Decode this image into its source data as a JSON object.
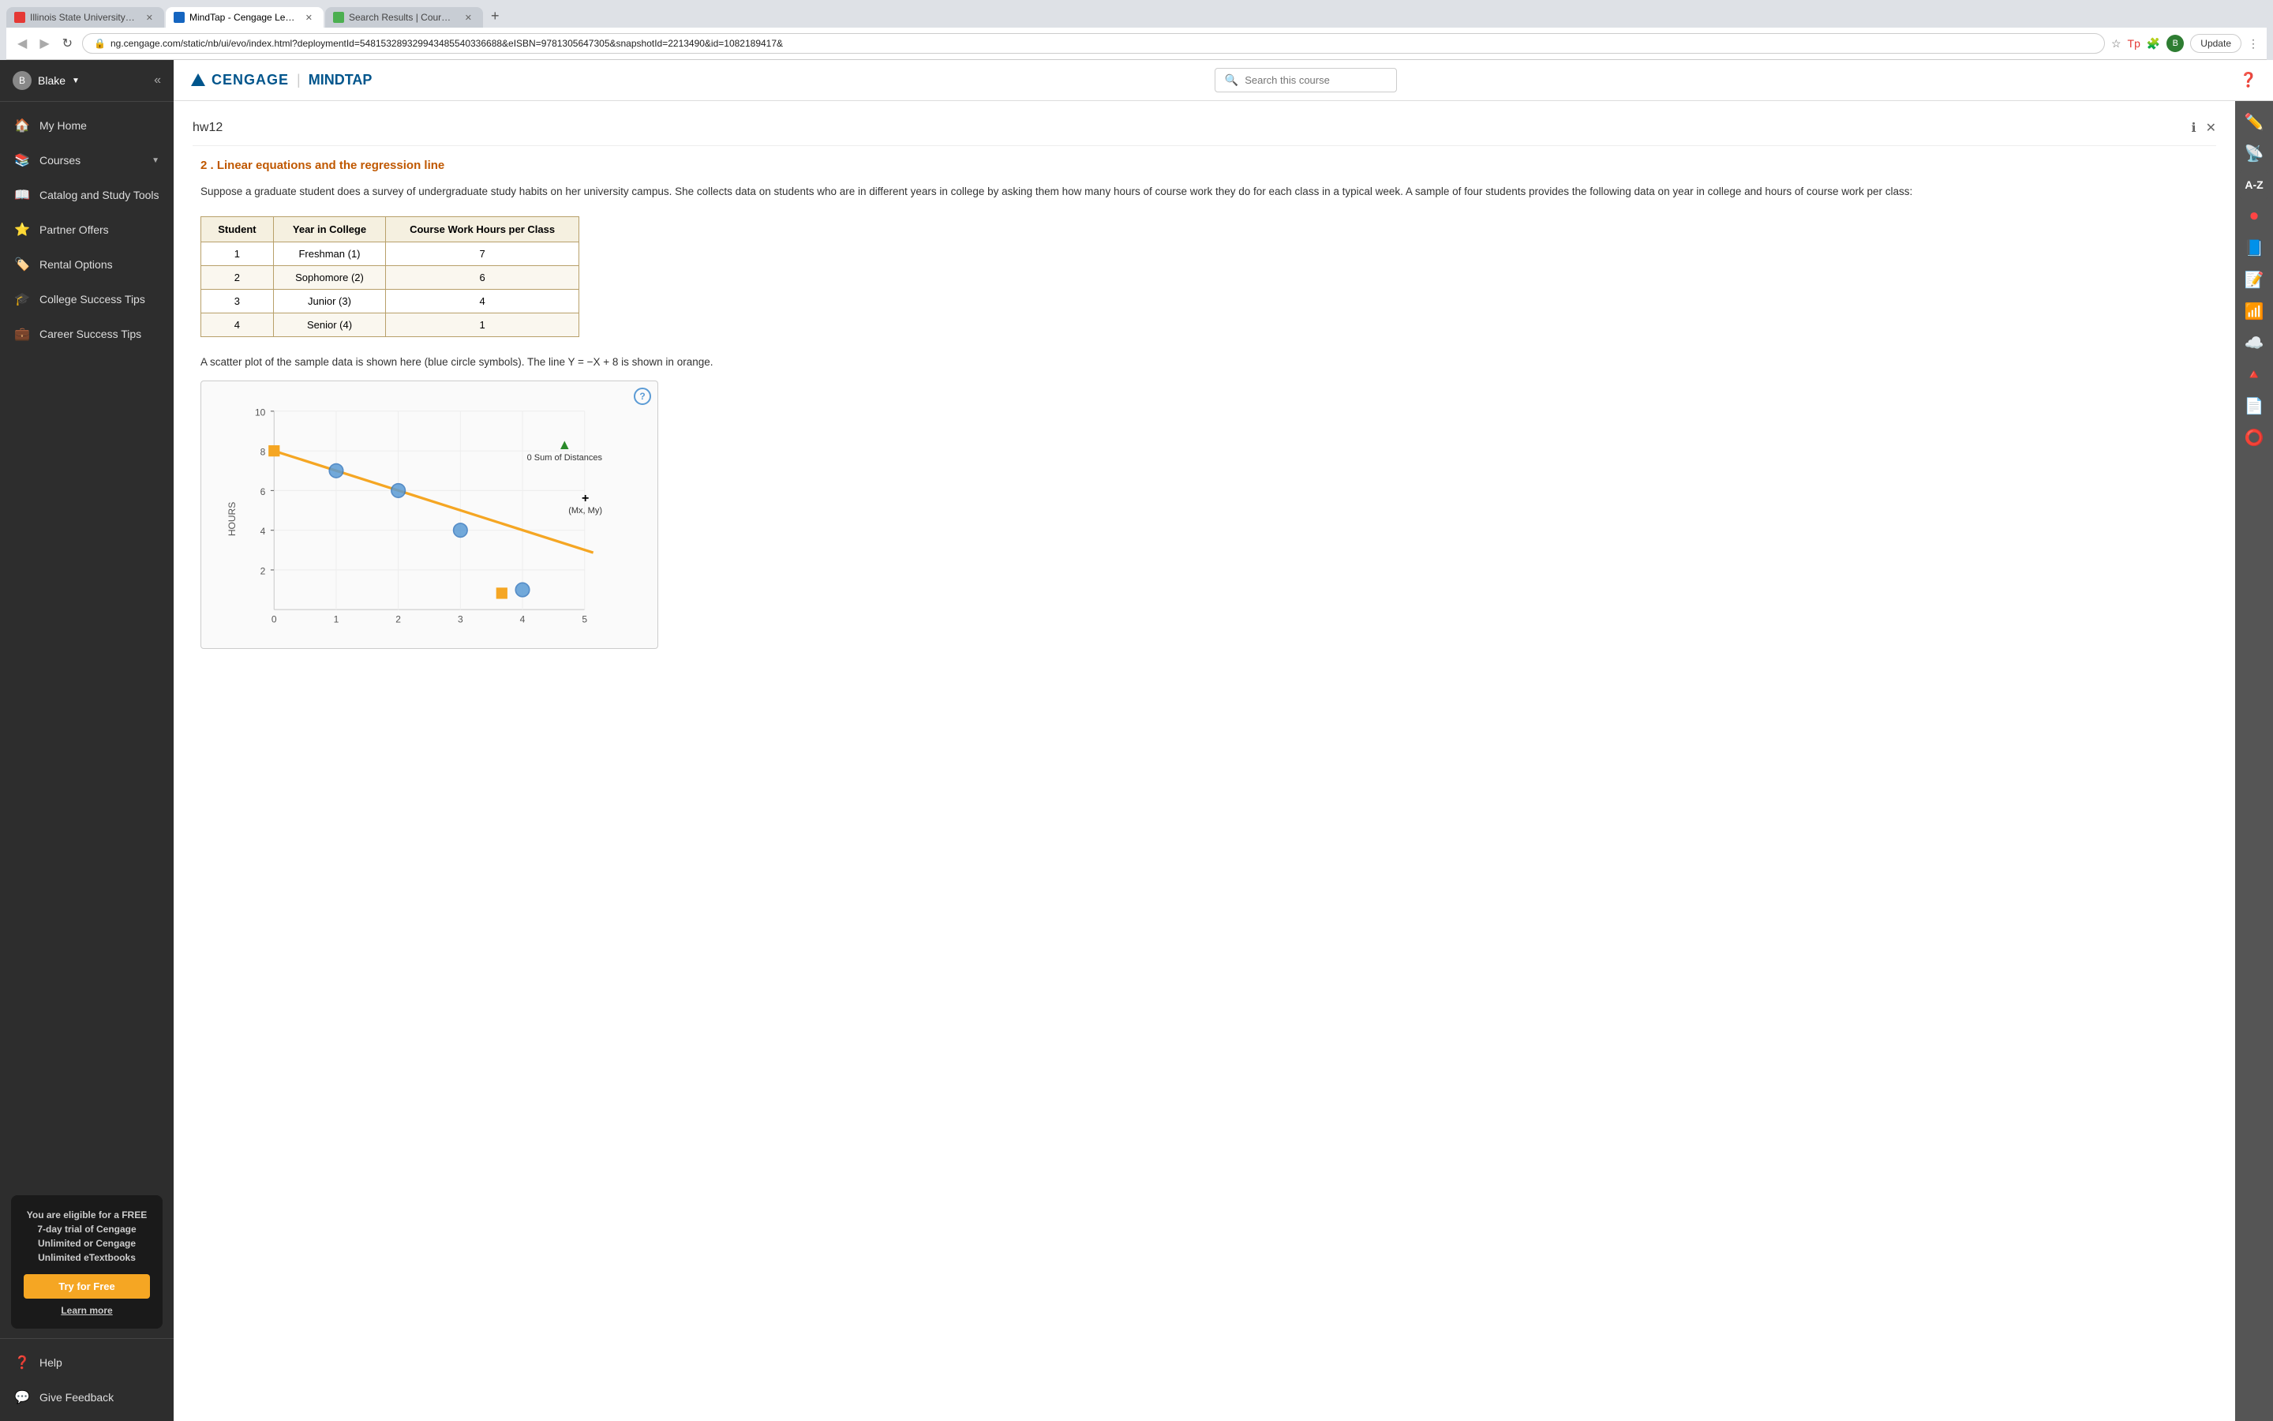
{
  "browser": {
    "tabs": [
      {
        "id": "tab1",
        "title": "Illinois State University : SOC...",
        "active": false,
        "favicon_color": "#e53935"
      },
      {
        "id": "tab2",
        "title": "MindTap - Cengage Learning",
        "active": true,
        "favicon_color": "#1565c0"
      },
      {
        "id": "tab3",
        "title": "Search Results | Course Hero",
        "active": false,
        "favicon_color": "#4caf50"
      }
    ],
    "url": "ng.cengage.com/static/nb/ui/evo/index.html?deploymentId=548153289329943485540336688&eISBN=9781305647305&snapshotId=2213490&id=1082189417&",
    "update_label": "Update",
    "user_initial": "B"
  },
  "sidebar": {
    "user": {
      "name": "Blake",
      "initial": "B"
    },
    "nav_items": [
      {
        "id": "my-home",
        "label": "My Home",
        "icon": "🏠"
      },
      {
        "id": "courses",
        "label": "Courses",
        "icon": "📚",
        "has_arrow": true
      },
      {
        "id": "catalog",
        "label": "Catalog and Study Tools",
        "icon": "📖"
      },
      {
        "id": "partner-offers",
        "label": "Partner Offers",
        "icon": "⭐"
      },
      {
        "id": "rental-options",
        "label": "Rental Options",
        "icon": "🏷️"
      },
      {
        "id": "college-tips",
        "label": "College Success Tips",
        "icon": "🎓"
      },
      {
        "id": "career-tips",
        "label": "Career Success Tips",
        "icon": "💼"
      }
    ],
    "promo": {
      "text": "You are eligible for a FREE 7-day trial of Cengage Unlimited or Cengage Unlimited eTextbooks",
      "try_label": "Try for Free",
      "learn_label": "Learn more"
    },
    "bottom_items": [
      {
        "id": "help",
        "label": "Help",
        "icon": "❓"
      },
      {
        "id": "feedback",
        "label": "Give Feedback",
        "icon": "💬"
      }
    ]
  },
  "header": {
    "logo_cengage": "CENGAGE",
    "logo_mindtap": "MINDTAP",
    "search_placeholder": "Search this course"
  },
  "content": {
    "hw_title": "hw12",
    "question": {
      "number": "2",
      "heading": "2 . Linear equations and the regression line",
      "body": "Suppose a graduate student does a survey of undergraduate study habits on her university campus. She collects data on students who are in different years in college by asking them how many hours of course work they do for each class in a typical week. A sample of four students provides the following data on year in college and hours of course work per class:",
      "table": {
        "headers": [
          "Student",
          "Year in College",
          "Course Work Hours per Class"
        ],
        "rows": [
          [
            "1",
            "Freshman (1)",
            "7"
          ],
          [
            "2",
            "Sophomore (2)",
            "6"
          ],
          [
            "3",
            "Junior (3)",
            "4"
          ],
          [
            "4",
            "Senior (4)",
            "1"
          ]
        ]
      },
      "scatter_desc": "A scatter plot of the sample data is shown here (blue circle symbols). The line Y = −X + 8 is shown in orange.",
      "chart": {
        "y_label": "HOURS",
        "y_max": 10,
        "y_min": 0,
        "x_min": 0,
        "x_max": 5,
        "line_label": "Y = -X + 8",
        "sum_distances_label": "0 Sum of Distances",
        "mean_point_label": "(Mx, My)",
        "triangle_icon": "▲",
        "plus_icon": "+"
      }
    }
  },
  "right_toolbar": {
    "icons": [
      {
        "id": "edit",
        "symbol": "✏️"
      },
      {
        "id": "rss",
        "symbol": "📡"
      },
      {
        "id": "az",
        "symbol": "🔤"
      },
      {
        "id": "record",
        "symbol": "🔴"
      },
      {
        "id": "book",
        "symbol": "📘"
      },
      {
        "id": "notes",
        "symbol": "📝"
      },
      {
        "id": "wifi-off",
        "symbol": "📶"
      },
      {
        "id": "cloud",
        "symbol": "☁️"
      },
      {
        "id": "drive",
        "symbol": "📂"
      },
      {
        "id": "doc",
        "symbol": "📄"
      },
      {
        "id": "circle",
        "symbol": "⭕"
      }
    ]
  }
}
